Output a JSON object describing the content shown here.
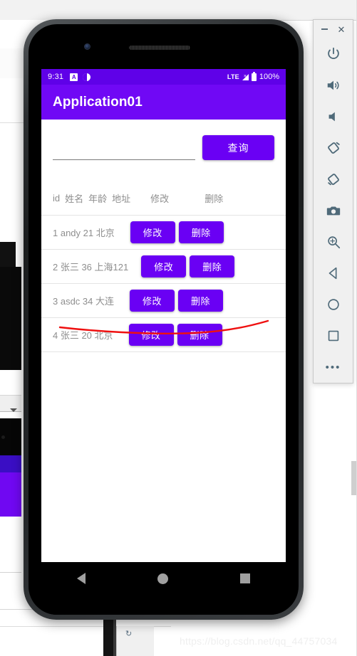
{
  "emulator": {
    "status_bar": {
      "time": "9:31",
      "left_icons": [
        "alarm-icon",
        "do-not-disturb-icon"
      ],
      "network": "LTE",
      "signal_icon": "signal-no-service-icon",
      "battery_icon": "battery-full-icon",
      "battery_percent": "100%"
    },
    "app_bar": {
      "title": "Application01"
    },
    "search": {
      "input_value": "",
      "placeholder": "",
      "query_button": "查询"
    },
    "table": {
      "headers": [
        "id",
        "姓名",
        "年龄",
        "地址",
        "修改",
        "删除"
      ],
      "rows": [
        {
          "label": "1 andy 21 北京",
          "edit": "修改",
          "delete": "删除"
        },
        {
          "label": "2 张三 36 上海121",
          "edit": "修改",
          "delete": "删除"
        },
        {
          "label": "3 asdc 34 大连",
          "edit": "修改",
          "delete": "删除"
        },
        {
          "label": "4 张三 20 北京",
          "edit": "修改",
          "delete": "删除"
        }
      ]
    },
    "nav_bar": {
      "back": "back-icon",
      "home": "home-icon",
      "recents": "recents-icon"
    },
    "colors": {
      "status_bar": "#5f01e8",
      "app_bar": "#7008f5",
      "button": "#6a00f4",
      "annotation": "#ef1010"
    }
  },
  "toolbar": {
    "minimize": "minimize-icon",
    "close": "close-icon",
    "buttons": [
      {
        "name": "power-button",
        "icon": "power-icon"
      },
      {
        "name": "volume-up-button",
        "icon": "volume-up-icon"
      },
      {
        "name": "volume-down-button",
        "icon": "volume-down-icon"
      },
      {
        "name": "rotate-left-button",
        "icon": "rotate-left-icon"
      },
      {
        "name": "rotate-right-button",
        "icon": "rotate-right-icon"
      },
      {
        "name": "screenshot-button",
        "icon": "camera-icon"
      },
      {
        "name": "zoom-button",
        "icon": "magnifier-icon"
      },
      {
        "name": "back-button",
        "icon": "back-triangle-icon"
      },
      {
        "name": "home-button",
        "icon": "home-circle-icon"
      },
      {
        "name": "overview-button",
        "icon": "overview-square-icon"
      },
      {
        "name": "more-button",
        "icon": "more-dots-icon"
      }
    ]
  },
  "watermark": {
    "text": "https://blog.csdn.net/qq_44757034"
  }
}
